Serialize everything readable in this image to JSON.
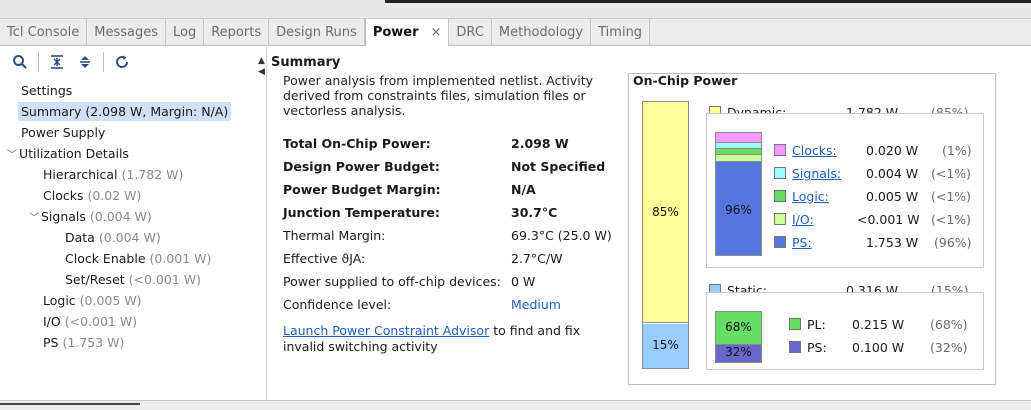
{
  "tabs": [
    {
      "label": "Tcl Console"
    },
    {
      "label": "Messages"
    },
    {
      "label": "Log"
    },
    {
      "label": "Reports"
    },
    {
      "label": "Design Runs"
    },
    {
      "label": "Power"
    },
    {
      "label": "DRC"
    },
    {
      "label": "Methodology"
    },
    {
      "label": "Timing"
    }
  ],
  "tab_close": "×",
  "tree": [
    {
      "label": "Settings",
      "value": ""
    },
    {
      "label": "Summary (2.098 W, Margin: N/A)",
      "value": ""
    },
    {
      "label": "Power Supply",
      "value": ""
    },
    {
      "label": "Utilization Details",
      "value": ""
    },
    {
      "label": "Hierarchical",
      "value": "(1.782 W)"
    },
    {
      "label": "Clocks",
      "value": "(0.02 W)"
    },
    {
      "label": "Signals",
      "value": "(0.004 W)"
    },
    {
      "label": "Data",
      "value": "(0.004 W)"
    },
    {
      "label": "Clock Enable",
      "value": "(0.001 W)"
    },
    {
      "label": "Set/Reset",
      "value": "(<0.001 W)"
    },
    {
      "label": "Logic",
      "value": "(0.005 W)"
    },
    {
      "label": "I/O",
      "value": "(<0.001 W)"
    },
    {
      "label": "PS",
      "value": "(1.753 W)"
    }
  ],
  "summary": {
    "title": "Summary",
    "intro": "Power analysis from implemented netlist. Activity derived from constraints files, simulation files or vectorless analysis.",
    "rows": [
      {
        "key": "Total On-Chip Power:",
        "value": "2.098 W"
      },
      {
        "key": "Design Power Budget:",
        "value": "Not Specified"
      },
      {
        "key": "Power Budget Margin:",
        "value": "N/A"
      },
      {
        "key": "Junction Temperature:",
        "value": "30.7°C"
      },
      {
        "key": "Thermal Margin:",
        "value": "69.3°C (25.0 W)"
      },
      {
        "key": "Effective ϑJA:",
        "value": "2.7°C/W"
      },
      {
        "key": "Power supplied to off-chip devices:",
        "value": "0 W"
      },
      {
        "key": "Confidence level:",
        "value": "Medium"
      }
    ],
    "advisor_link": "Launch Power Constraint Advisor",
    "advisor_text": " to find and fix invalid switching activity"
  },
  "onchip": {
    "title": "On-Chip Power",
    "dynamic_pct": "85%",
    "static_pct": "15%",
    "dynamic_fraction": 0.85,
    "dynamic": {
      "label": "Dynamic:",
      "value": "1.782 W",
      "pct": "(85%)",
      "color": "#ffff99"
    },
    "static": {
      "label": "Static:",
      "value": "0.316 W",
      "pct": "(15%)",
      "color": "#99ccff"
    },
    "dynamic_items": [
      {
        "label": "Clocks:",
        "value": "0.020 W",
        "pct": "(1%)",
        "color": "#ff99ff"
      },
      {
        "label": "Signals:",
        "value": "0.004 W",
        "pct": "(<1%)",
        "color": "#99ffff"
      },
      {
        "label": "Logic:",
        "value": "0.005 W",
        "pct": "(<1%)",
        "color": "#66dd66"
      },
      {
        "label": "I/O:",
        "value": "<0.001 W",
        "pct": "(<1%)",
        "color": "#ccff99"
      },
      {
        "label": "PS:",
        "value": "1.753 W",
        "pct": "(96%)",
        "color": "#5577dd"
      }
    ],
    "dynamic_bar_pct": "96%",
    "static_items": [
      {
        "label": "PL:",
        "value": "0.215 W",
        "pct": "(68%)",
        "color": "#66dd66"
      },
      {
        "label": "PS:",
        "value": "0.100 W",
        "pct": "(32%)",
        "color": "#6666cc"
      }
    ],
    "static_bar_pl": "68%",
    "static_bar_ps": "32%"
  }
}
